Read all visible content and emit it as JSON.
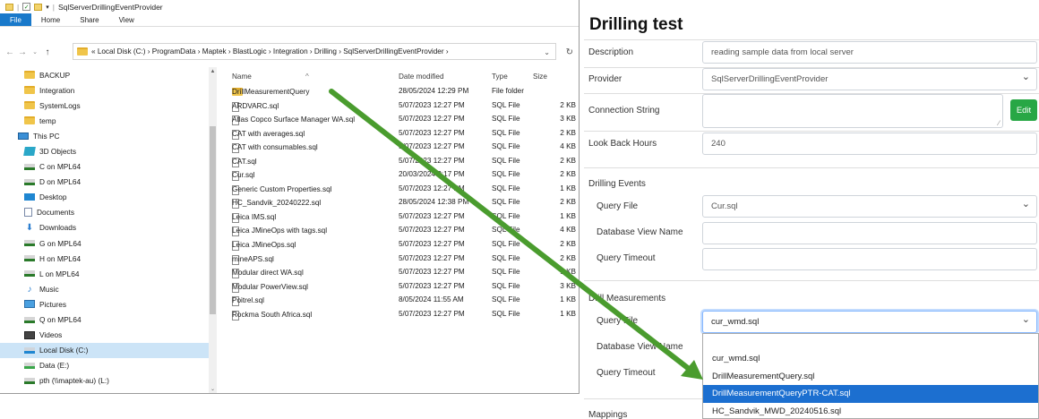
{
  "explorer": {
    "title": "SqlServerDrillingEventProvider",
    "ribbon_tabs": [
      "File",
      "Home",
      "Share",
      "View"
    ],
    "breadcrumb": "« Local Disk (C:) › ProgramData › Maptek › BlastLogic › Integration › Drilling › SqlServerDrillingEventProvider ›",
    "nav_items": [
      {
        "label": "BACKUP",
        "icon": "folder-icon"
      },
      {
        "label": "Integration",
        "icon": "folder-icon"
      },
      {
        "label": "SystemLogs",
        "icon": "folder-icon"
      },
      {
        "label": "temp",
        "icon": "folder-icon"
      },
      {
        "label": "This PC",
        "icon": "pc-icon"
      },
      {
        "label": "3D Objects",
        "icon": "3d-objects-icon"
      },
      {
        "label": "C on MPL64",
        "icon": "network-drive-icon"
      },
      {
        "label": "D on MPL64",
        "icon": "network-drive-icon"
      },
      {
        "label": "Desktop",
        "icon": "desktop-icon"
      },
      {
        "label": "Documents",
        "icon": "documents-icon"
      },
      {
        "label": "Downloads",
        "icon": "downloads-icon"
      },
      {
        "label": "G on MPL64",
        "icon": "network-drive-icon"
      },
      {
        "label": "H on MPL64",
        "icon": "network-drive-icon"
      },
      {
        "label": "L on MPL64",
        "icon": "network-drive-icon"
      },
      {
        "label": "Music",
        "icon": "music-icon"
      },
      {
        "label": "Pictures",
        "icon": "pictures-icon"
      },
      {
        "label": "Q on MPL64",
        "icon": "network-drive-icon"
      },
      {
        "label": "Videos",
        "icon": "videos-icon"
      },
      {
        "label": "Local Disk (C:)",
        "icon": "local-disk-icon"
      },
      {
        "label": "Data (E:)",
        "icon": "drive-icon"
      },
      {
        "label": "pth (\\\\maptek-au) (L:)",
        "icon": "mapped-drive-icon"
      }
    ],
    "columns": {
      "name": "Name",
      "date": "Date modified",
      "type": "Type",
      "size": "Size"
    },
    "files": [
      {
        "name": "DrillMeasurementQuery",
        "date": "28/05/2024 12:29 PM",
        "type": "File folder",
        "size": "",
        "folder": true
      },
      {
        "name": "ARDVARC.sql",
        "date": "5/07/2023 12:27 PM",
        "type": "SQL File",
        "size": "2 KB"
      },
      {
        "name": "Atlas Copco Surface Manager WA.sql",
        "date": "5/07/2023 12:27 PM",
        "type": "SQL File",
        "size": "3 KB"
      },
      {
        "name": "CAT with averages.sql",
        "date": "5/07/2023 12:27 PM",
        "type": "SQL File",
        "size": "2 KB"
      },
      {
        "name": "CAT with consumables.sql",
        "date": "5/07/2023 12:27 PM",
        "type": "SQL File",
        "size": "4 KB"
      },
      {
        "name": "CAT.sql",
        "date": "5/07/2023 12:27 PM",
        "type": "SQL File",
        "size": "2 KB"
      },
      {
        "name": "Cur.sql",
        "date": "20/03/2024 2:17 PM",
        "type": "SQL File",
        "size": "2 KB"
      },
      {
        "name": "Generic Custom Properties.sql",
        "date": "5/07/2023 12:27 PM",
        "type": "SQL File",
        "size": "1 KB"
      },
      {
        "name": "HC_Sandvik_20240222.sql",
        "date": "28/05/2024 12:38 PM",
        "type": "SQL File",
        "size": "2 KB"
      },
      {
        "name": "Leica IMS.sql",
        "date": "5/07/2023 12:27 PM",
        "type": "SQL File",
        "size": "1 KB"
      },
      {
        "name": "Leica JMineOps with tags.sql",
        "date": "5/07/2023 12:27 PM",
        "type": "SQL File",
        "size": "4 KB"
      },
      {
        "name": "Leica JMineOps.sql",
        "date": "5/07/2023 12:27 PM",
        "type": "SQL File",
        "size": "2 KB"
      },
      {
        "name": "mineAPS.sql",
        "date": "5/07/2023 12:27 PM",
        "type": "SQL File",
        "size": "2 KB"
      },
      {
        "name": "Modular direct WA.sql",
        "date": "5/07/2023 12:27 PM",
        "type": "SQL File",
        "size": "1 KB"
      },
      {
        "name": "Modular PowerView.sql",
        "date": "5/07/2023 12:27 PM",
        "type": "SQL File",
        "size": "3 KB"
      },
      {
        "name": "Poitrel.sql",
        "date": "8/05/2024 11:55 AM",
        "type": "SQL File",
        "size": "1 KB"
      },
      {
        "name": "Rockma South Africa.sql",
        "date": "5/07/2023 12:27 PM",
        "type": "SQL File",
        "size": "1 KB"
      }
    ]
  },
  "settings": {
    "title": "Drilling test",
    "description_label": "Description",
    "description_value": "reading sample data from local server",
    "provider_label": "Provider",
    "provider_value": "SqlServerDrillingEventProvider",
    "connection_label": "Connection String",
    "edit_button": "Edit",
    "lookback_label": "Look Back Hours",
    "lookback_value": "240",
    "drilling_events": {
      "section": "Drilling Events",
      "query_file_label": "Query File",
      "query_file_value": "Cur.sql",
      "view_name_label": "Database View Name",
      "timeout_label": "Query Timeout"
    },
    "drill_measurements": {
      "section": "Drill Measurements",
      "query_file_label": "Query File",
      "query_file_value": "cur_wmd.sql",
      "view_name_label": "Database View Name",
      "timeout_label": "Query Timeout"
    },
    "mappings_label": "Mappings",
    "dropdown_options": [
      "cur_wmd.sql",
      "DrillMeasurementQuery.sql",
      "DrillMeasurementQueryPTR-CAT.sql",
      "HC_Sandvik_MWD_20240516.sql"
    ],
    "dropdown_selected": "DrillMeasurementQueryPTR-CAT.sql"
  },
  "colors": {
    "accent": "#1c6fd0",
    "edit_button": "#28a745",
    "arrow": "#4a9c2e"
  }
}
